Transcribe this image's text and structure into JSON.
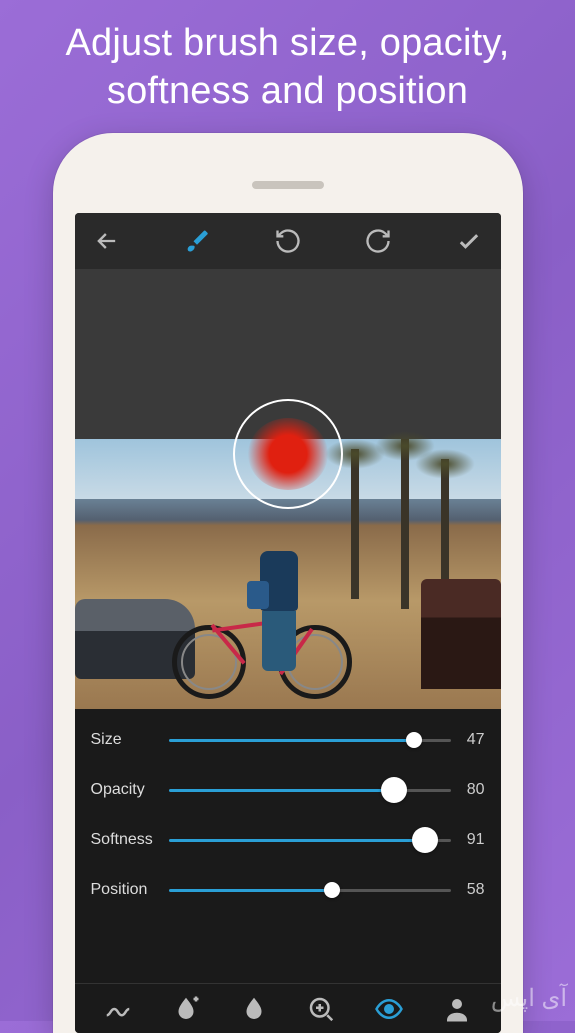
{
  "headline": "Adjust brush size, opacity, softness and position",
  "toolbar": {
    "back": "back",
    "brush": "brush",
    "undo": "undo",
    "redo": "redo",
    "apply": "apply"
  },
  "sliders": [
    {
      "label": "Size",
      "value": 47,
      "max": 100,
      "thumb": "small"
    },
    {
      "label": "Opacity",
      "value": 80,
      "max": 100,
      "thumb": "large"
    },
    {
      "label": "Softness",
      "value": 91,
      "max": 100,
      "thumb": "large"
    },
    {
      "label": "Position",
      "value": 58,
      "max": 100,
      "thumb": "small"
    }
  ],
  "bottom_tools": [
    {
      "name": "squiggle",
      "active": false
    },
    {
      "name": "drop-plus",
      "active": false
    },
    {
      "name": "drop",
      "active": false
    },
    {
      "name": "zoom-in",
      "active": false
    },
    {
      "name": "eye",
      "active": true
    },
    {
      "name": "person",
      "active": false
    }
  ],
  "watermark": "آی اپس",
  "colors": {
    "accent": "#2a9fd6",
    "brush": "#e02010"
  }
}
